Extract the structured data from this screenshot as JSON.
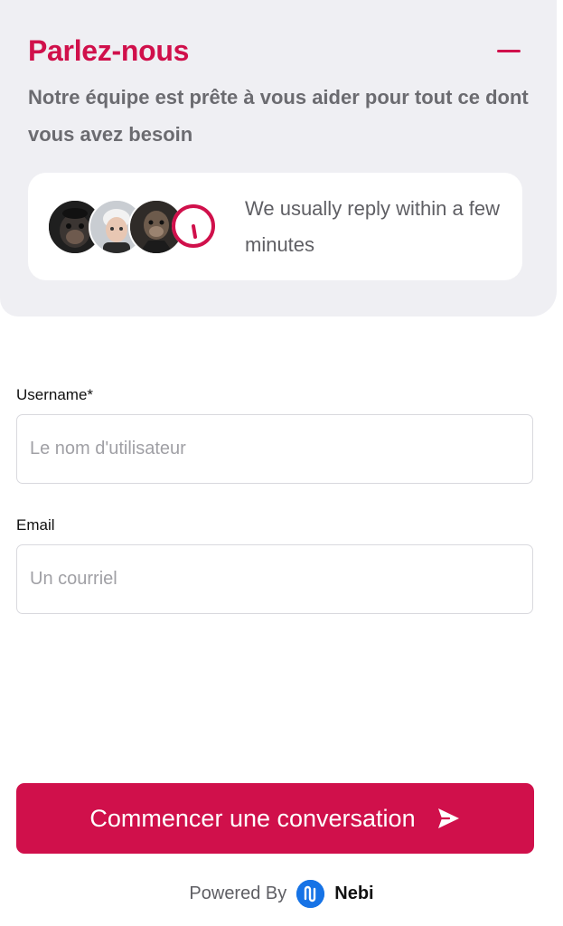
{
  "header": {
    "title": "Parlez-nous",
    "subtitle": "Notre équipe est prête à vous aider pour tout ce dont vous avez besoin",
    "collapse_icon": "minus-icon",
    "accent_color": "#d0104b",
    "background_color": "#efeff3"
  },
  "reply_card": {
    "text": "We usually reply within a few minutes",
    "avatars": [
      {
        "icon": "avatar-ape-dark"
      },
      {
        "icon": "avatar-character-white-hair"
      },
      {
        "icon": "avatar-ape-suit"
      }
    ],
    "clock_icon": "clock-icon"
  },
  "form": {
    "username": {
      "label": "Username*",
      "placeholder": "Le nom d'utilisateur",
      "value": ""
    },
    "email": {
      "label": "Email",
      "placeholder": "Un courriel",
      "value": ""
    },
    "submit": {
      "label": "Commencer une conversation",
      "icon": "send-icon",
      "color": "#d0104b"
    }
  },
  "footer": {
    "powered_by": "Powered By",
    "brand_name": "Nebi",
    "brand_icon": "nebi-logo-icon",
    "brand_color": "#1673e6"
  }
}
